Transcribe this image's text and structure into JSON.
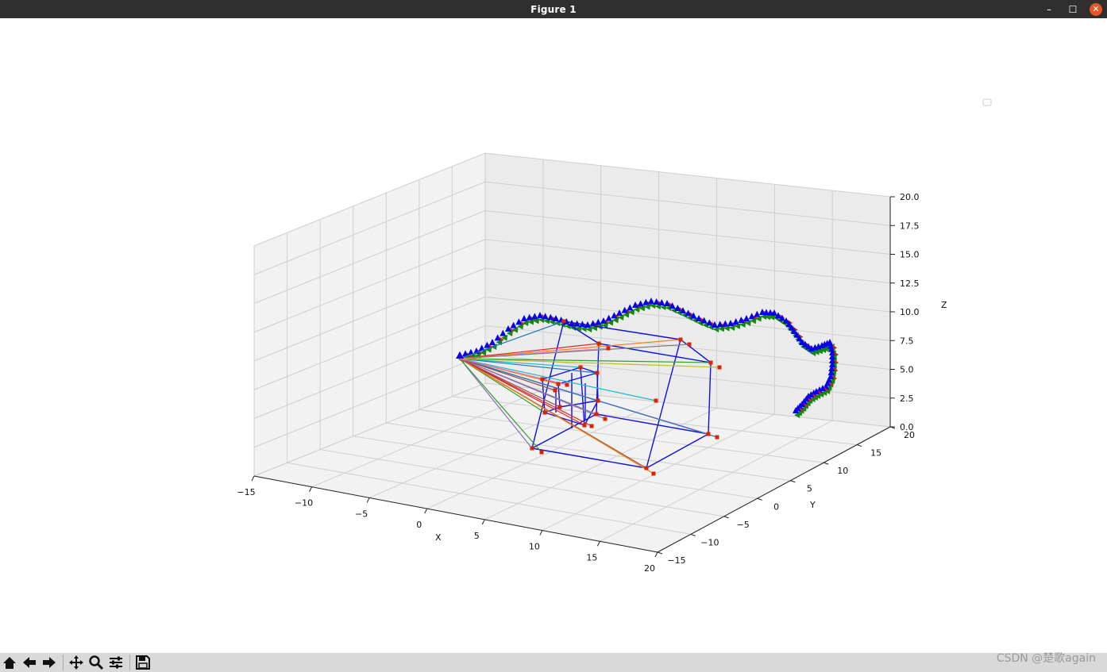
{
  "window": {
    "title": "Figure 1",
    "minimize_icon": "minimize-icon",
    "maximize_icon": "maximize-icon",
    "close_icon": "close-icon"
  },
  "chart_data": {
    "type": "scatter",
    "title": "",
    "xlabel": "X",
    "ylabel": "Y",
    "zlabel": "Z",
    "x_ticks": [
      "−15",
      "−10",
      "−5",
      "0",
      "5",
      "10",
      "15",
      "20"
    ],
    "y_ticks": [
      "−15",
      "−10",
      "−5",
      "0",
      "5",
      "10",
      "15",
      "20"
    ],
    "z_ticks": [
      "0.0",
      "2.5",
      "5.0",
      "7.5",
      "10.0",
      "12.5",
      "15.0",
      "17.5",
      "20.0"
    ],
    "xlim": [
      -15,
      20
    ],
    "ylim": [
      -15,
      20
    ],
    "zlim": [
      0,
      20
    ],
    "grid": true,
    "legend": "top-right (empty)",
    "colors": {
      "wireframe": "#1010dd",
      "points": "#dd2200",
      "pose_up": "#0000ee",
      "pose_fwd": "#118811",
      "pose_side": "#ee1111"
    }
  },
  "toolbar": {
    "buttons": [
      {
        "name": "home-button",
        "icon": "home-icon"
      },
      {
        "name": "back-button",
        "icon": "arrow-left-icon"
      },
      {
        "name": "forward-button",
        "icon": "arrow-right-icon"
      },
      {
        "name": "pan-button",
        "icon": "move-icon"
      },
      {
        "name": "zoom-button",
        "icon": "magnifier-icon"
      },
      {
        "name": "configure-button",
        "icon": "sliders-icon"
      },
      {
        "name": "save-button",
        "icon": "floppy-disk-icon"
      }
    ]
  },
  "watermark": "CSDN @楚歌again"
}
